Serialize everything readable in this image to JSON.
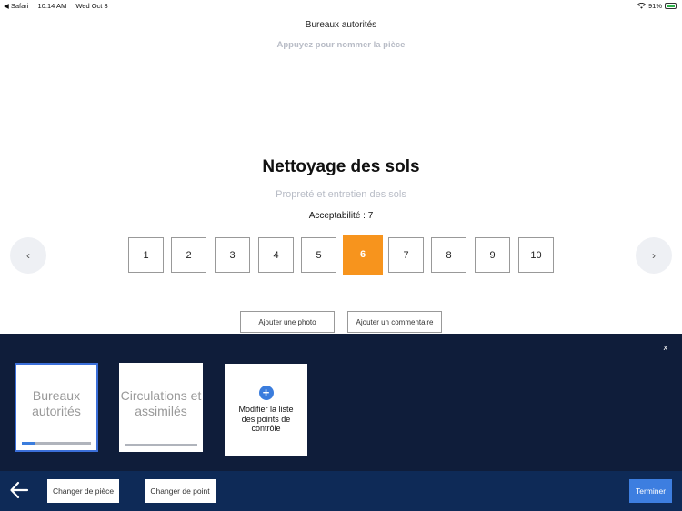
{
  "status_bar": {
    "back_app": "◀ Safari",
    "time": "10:14 AM",
    "date": "Wed Oct 3",
    "battery": "91%"
  },
  "header": {
    "room_name": "Bureaux autorités",
    "room_hint": "Appuyez pour nommer la pièce"
  },
  "control_point": {
    "title": "Nettoyage des sols",
    "subtitle": "Propreté et entretien des sols",
    "acceptability_label": "Acceptabilité :",
    "acceptability_value": "7"
  },
  "navigation": {
    "prev_glyph": "‹",
    "next_glyph": "›"
  },
  "scores": {
    "options": [
      "1",
      "2",
      "3",
      "4",
      "5",
      "6",
      "7",
      "8",
      "9",
      "10"
    ],
    "selected": "6"
  },
  "actions": {
    "add_photo": "Ajouter une photo",
    "add_comment": "Ajouter un commentaire"
  },
  "panel": {
    "close_label": "x",
    "rooms": [
      {
        "label": "Bureaux autorités",
        "progress": 0.2,
        "selected": true
      },
      {
        "label": "Circulations et assimilés",
        "progress": 0.0,
        "selected": false
      }
    ],
    "modify_label": "Modifier la liste des points de contrôle",
    "plus_glyph": "+"
  },
  "bottom_bar": {
    "change_room": "Changer de pièce",
    "change_point": "Changer de point",
    "finish": "Terminer"
  },
  "colors": {
    "accent_orange": "#f7941d",
    "panel_bg": "#0f1d3a",
    "bottom_bg": "#0e2a57",
    "primary_blue": "#3d7ee0"
  }
}
